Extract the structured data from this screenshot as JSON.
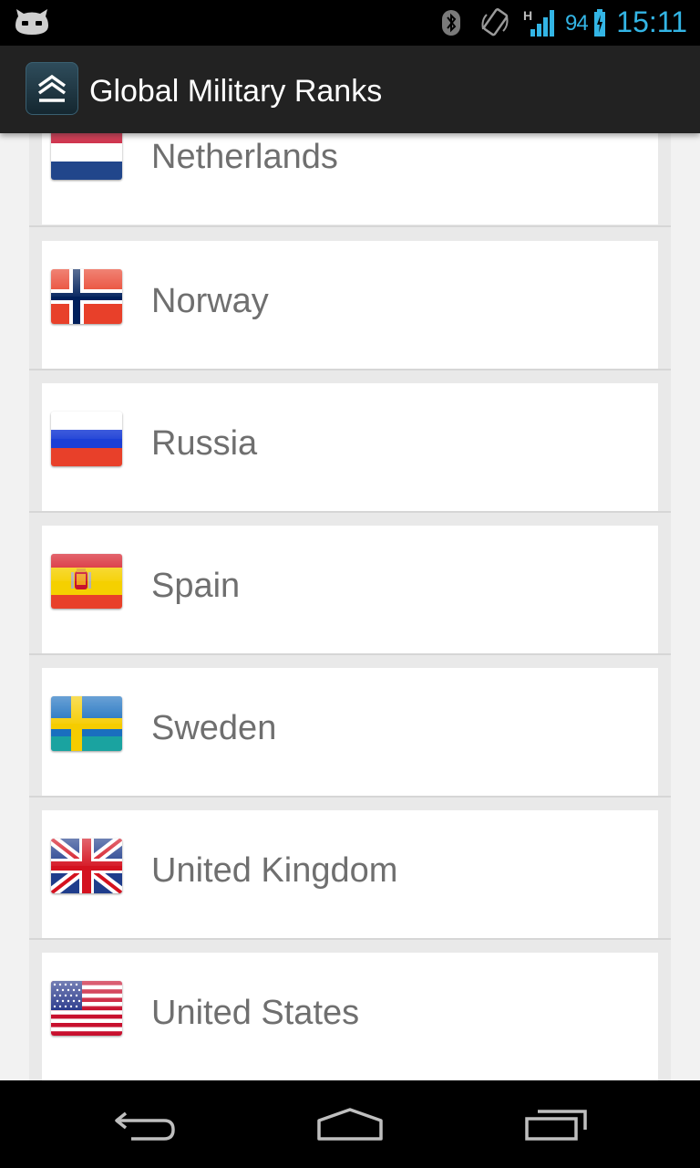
{
  "status_bar": {
    "battery_percent": "94",
    "time": "15:11",
    "network_type": "H",
    "accent_color": "#33b5e5"
  },
  "action_bar": {
    "title": "Global Military Ranks",
    "icon": "chevron-rank-icon"
  },
  "countries": [
    {
      "name": "Netherlands",
      "flag_icon": "netherlands-flag-icon"
    },
    {
      "name": "Norway",
      "flag_icon": "norway-flag-icon"
    },
    {
      "name": "Russia",
      "flag_icon": "russia-flag-icon"
    },
    {
      "name": "Spain",
      "flag_icon": "spain-flag-icon"
    },
    {
      "name": "Sweden",
      "flag_icon": "sweden-flag-icon"
    },
    {
      "name": "United Kingdom",
      "flag_icon": "uk-flag-icon"
    },
    {
      "name": "United States",
      "flag_icon": "usa-flag-icon"
    }
  ],
  "nav_bar": {
    "back": "back-icon",
    "home": "home-icon",
    "recents": "recent-apps-icon"
  }
}
